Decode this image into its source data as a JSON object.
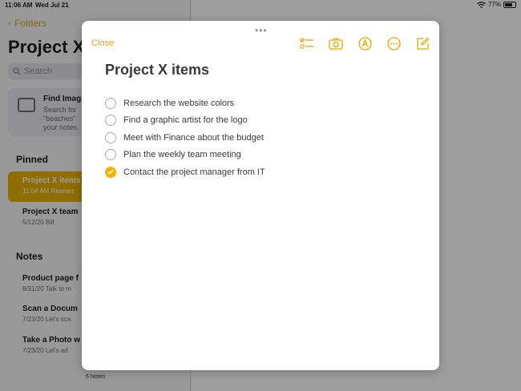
{
  "status_bar": {
    "time": "11:06 AM",
    "date": "Wed Jul 21",
    "battery": "77%",
    "battery_level": 0.77
  },
  "sidebar": {
    "back_label": "Folders",
    "title": "Project X",
    "search_placeholder": "Search",
    "find_card": {
      "title": "Find Imag",
      "lines": [
        "Search for",
        "\"beaches\"",
        "your notes."
      ]
    },
    "pinned_header": "Pinned",
    "pinned": [
      {
        "title": "Project X items",
        "meta": "11:04 AM  Researc"
      },
      {
        "title": "Project X team",
        "meta": "5/12/20  Bill"
      }
    ],
    "notes_header": "Notes",
    "notes": [
      {
        "title": "Product page f",
        "meta": "8/31/20  Talk to m"
      },
      {
        "title": "Scan a Docum",
        "meta": "7/23/20  Let's sca"
      },
      {
        "title": "Take a Photo w",
        "meta": "7/23/20  Let's ad"
      }
    ],
    "notes_count": "6 Notes"
  },
  "modal": {
    "grabber": "•••",
    "close_label": "Close",
    "toolbar_icons": [
      "checklist-icon",
      "camera-icon",
      "markup-icon",
      "more-icon",
      "compose-icon"
    ],
    "title": "Project X items",
    "checklist": [
      {
        "text": "Research the website colors",
        "checked": false
      },
      {
        "text": "Find a graphic artist for the logo",
        "checked": false
      },
      {
        "text": "Meet with Finance about the budget",
        "checked": false
      },
      {
        "text": "Plan the weekly team meeting",
        "checked": false
      },
      {
        "text": "Contact the project manager from IT",
        "checked": true
      }
    ]
  },
  "colors": {
    "accent": "#e0a800",
    "check": "#f0b400",
    "text": "#3a3a3c"
  }
}
